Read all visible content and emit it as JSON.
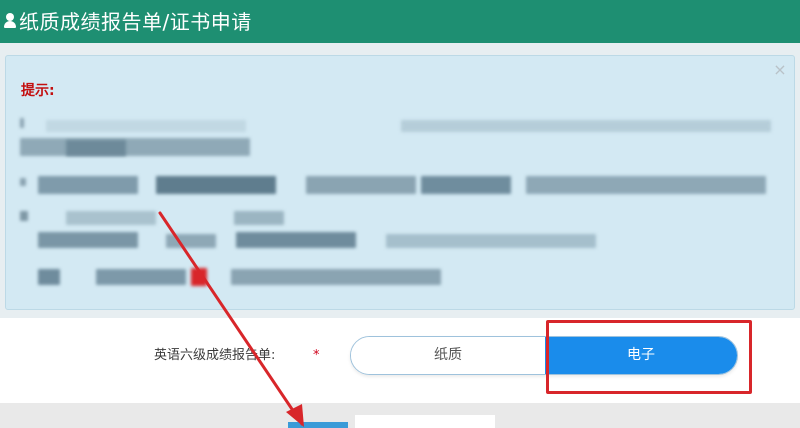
{
  "header": {
    "title": "纸质成绩报告单/证书申请",
    "icon": "user-icon",
    "color": "#1e8f72"
  },
  "notice": {
    "label": "提示:",
    "close_symbol": "×",
    "close_icon": "close-icon"
  },
  "form": {
    "field_label": "英语六级成绩报告单:",
    "required_mark": "*",
    "options": [
      {
        "label": "纸质",
        "selected": false
      },
      {
        "label": "电子",
        "selected": true
      }
    ],
    "selected_color": "#1a8ceb"
  },
  "annotation": {
    "arrow_color": "#d8262a",
    "box_color": "#d8262a"
  }
}
